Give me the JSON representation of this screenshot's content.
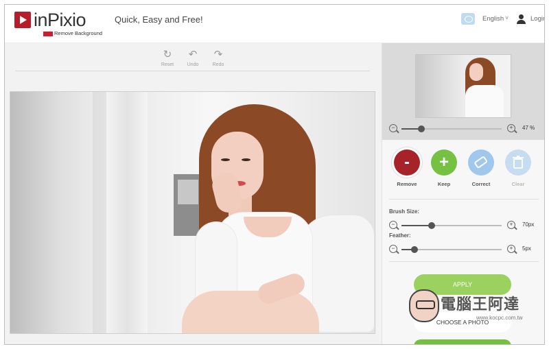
{
  "header": {
    "brand": "inPixio",
    "brand_sub": "Remove Background",
    "tagline": "Quick, Easy and Free!",
    "language": "English",
    "login": "Login"
  },
  "toolbar": {
    "reset": "Reset",
    "undo": "Undo",
    "redo": "Redo"
  },
  "panel": {
    "zoom_value": "47 %",
    "zoom_level": 0.2,
    "tools": [
      {
        "label": "Remove",
        "symbol": "-",
        "icon": "minus-icon"
      },
      {
        "label": "Keep",
        "symbol": "+",
        "icon": "plus-icon"
      },
      {
        "label": "Correct",
        "symbol": "",
        "icon": "eraser-icon"
      },
      {
        "label": "Clear",
        "symbol": "",
        "icon": "trash-icon"
      }
    ],
    "brush_size_label": "Brush Size:",
    "brush_size_value": "70px",
    "brush_size_level": 0.3,
    "feather_label": "Feather:",
    "feather_value": "5px",
    "feather_level": 0.13,
    "apply": "APPLY",
    "choose_photo": "CHOOSE A PHOTO"
  },
  "watermark": {
    "title": "電腦王阿達",
    "url": "www.kocpc.com.tw"
  },
  "colors": {
    "remove": "#a52329",
    "keep": "#76c142",
    "correct": "#9fc8ec",
    "clear": "#c6dcf1",
    "apply": "#9ad15f"
  }
}
